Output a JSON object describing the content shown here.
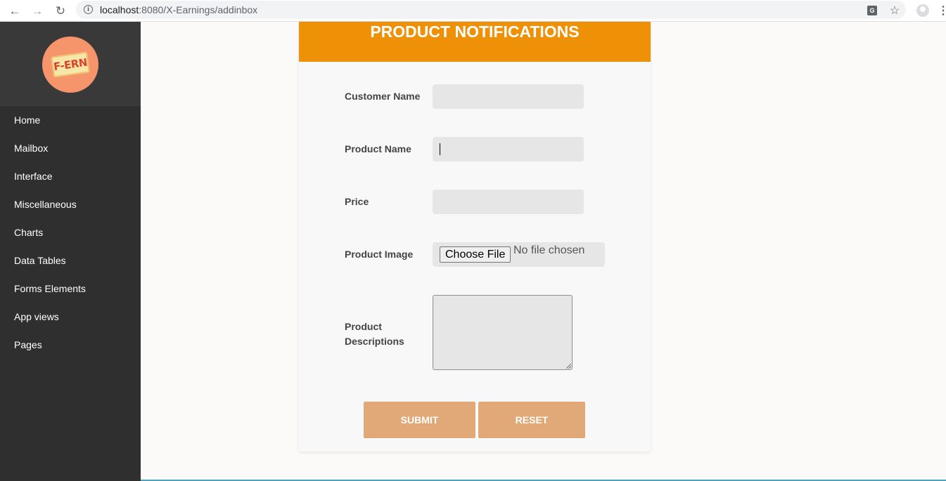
{
  "browser": {
    "url_host": "localhost",
    "url_rest": ":8080/X-Earnings/addinbox"
  },
  "sidebar": {
    "logo_text": "F-ERN",
    "items": [
      {
        "label": "Home"
      },
      {
        "label": "Mailbox"
      },
      {
        "label": "Interface"
      },
      {
        "label": "Miscellaneous"
      },
      {
        "label": "Charts"
      },
      {
        "label": "Data Tables"
      },
      {
        "label": "Forms Elements"
      },
      {
        "label": "App views"
      },
      {
        "label": "Pages"
      }
    ]
  },
  "form": {
    "title": "PRODUCT NOTIFICATIONS",
    "customer_name_label": "Customer Name",
    "customer_name_value": "",
    "product_name_label": "Product Name",
    "product_name_value": "",
    "price_label": "Price",
    "price_value": "",
    "product_image_label": "Product Image",
    "choose_file_label": "Choose File",
    "file_status": "No file chosen",
    "descriptions_label_line1": "Product",
    "descriptions_label_line2": "Descriptions",
    "submit_label": "SUBMIT",
    "reset_label": "RESET"
  },
  "colors": {
    "header_orange": "#ee9106",
    "button_tan": "#e2a978",
    "sidebar_dark": "#2f2f2f"
  }
}
